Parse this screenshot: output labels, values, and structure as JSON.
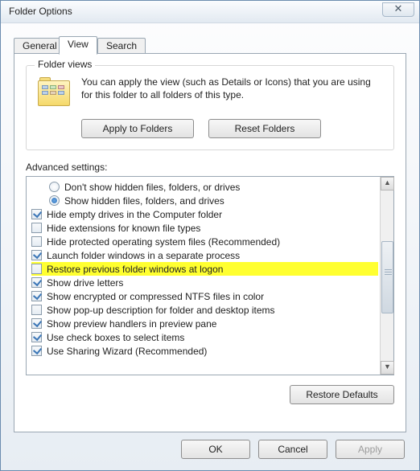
{
  "window": {
    "title": "Folder Options"
  },
  "tabs": {
    "general": "General",
    "view": "View",
    "search": "Search"
  },
  "folderViews": {
    "groupTitle": "Folder views",
    "description": "You can apply the view (such as Details or Icons) that you are using for this folder to all folders of this type.",
    "applyBtn": "Apply to Folders",
    "resetBtn": "Reset Folders"
  },
  "advanced": {
    "label": "Advanced settings:",
    "items": [
      {
        "kind": "radio",
        "checked": false,
        "indent": true,
        "hl": false,
        "text": "Don't show hidden files, folders, or drives"
      },
      {
        "kind": "radio",
        "checked": true,
        "indent": true,
        "hl": false,
        "text": "Show hidden files, folders, and drives"
      },
      {
        "kind": "checkbox",
        "checked": true,
        "indent": false,
        "hl": false,
        "text": "Hide empty drives in the Computer folder"
      },
      {
        "kind": "checkbox",
        "checked": false,
        "indent": false,
        "hl": false,
        "text": "Hide extensions for known file types"
      },
      {
        "kind": "checkbox",
        "checked": false,
        "indent": false,
        "hl": false,
        "text": "Hide protected operating system files (Recommended)"
      },
      {
        "kind": "checkbox",
        "checked": true,
        "indent": false,
        "hl": false,
        "text": "Launch folder windows in a separate process"
      },
      {
        "kind": "checkbox",
        "checked": false,
        "indent": false,
        "hl": true,
        "text": "Restore previous folder windows at logon"
      },
      {
        "kind": "checkbox",
        "checked": true,
        "indent": false,
        "hl": false,
        "text": "Show drive letters"
      },
      {
        "kind": "checkbox",
        "checked": true,
        "indent": false,
        "hl": false,
        "text": "Show encrypted or compressed NTFS files in color"
      },
      {
        "kind": "checkbox",
        "checked": false,
        "indent": false,
        "hl": false,
        "text": "Show pop-up description for folder and desktop items"
      },
      {
        "kind": "checkbox",
        "checked": true,
        "indent": false,
        "hl": false,
        "text": "Show preview handlers in preview pane"
      },
      {
        "kind": "checkbox",
        "checked": true,
        "indent": false,
        "hl": false,
        "text": "Use check boxes to select items"
      },
      {
        "kind": "checkbox",
        "checked": true,
        "indent": false,
        "hl": false,
        "text": "Use Sharing Wizard (Recommended)"
      }
    ],
    "restoreBtn": "Restore Defaults"
  },
  "buttons": {
    "ok": "OK",
    "cancel": "Cancel",
    "apply": "Apply"
  }
}
